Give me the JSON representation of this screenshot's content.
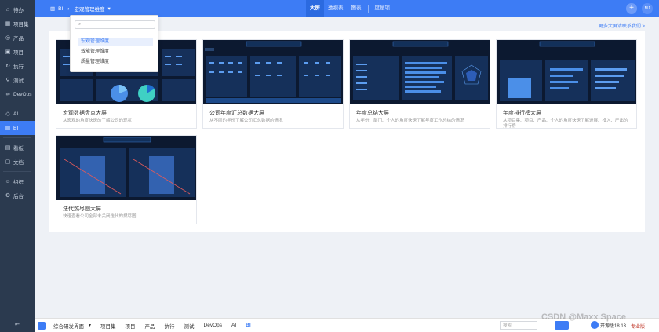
{
  "sidebar": {
    "items": [
      {
        "label": "待办",
        "icon": "home-icon"
      },
      {
        "label": "项目集",
        "icon": "project-set-icon"
      },
      {
        "label": "产品",
        "icon": "product-icon"
      },
      {
        "label": "项目",
        "icon": "project-icon"
      },
      {
        "label": "执行",
        "icon": "execution-icon"
      },
      {
        "label": "测试",
        "icon": "test-icon"
      },
      {
        "label": "DevOps",
        "icon": "devops-icon"
      },
      {
        "label": "AI",
        "icon": "ai-icon"
      },
      {
        "label": "BI",
        "icon": "bi-icon"
      },
      {
        "label": "看板",
        "icon": "kanban-icon"
      },
      {
        "label": "文档",
        "icon": "doc-icon"
      },
      {
        "label": "组织",
        "icon": "org-icon"
      },
      {
        "label": "后台",
        "icon": "admin-icon"
      }
    ],
    "collapse": "⇤"
  },
  "topbar": {
    "module": "BI",
    "dimension": "宏观管理维度",
    "tabs": [
      "大屏",
      "透视表",
      "图表",
      "度量项"
    ],
    "avatar": "MJ",
    "accent": "#3d7cf5"
  },
  "dropdown": {
    "search_placeholder": "",
    "options": [
      "宏观管理维度",
      "效能管理维度",
      "质量管理维度"
    ]
  },
  "more_link": "更多大屏请联系我们 >",
  "cards": [
    {
      "title": "宏观数据盘点大屏",
      "desc": "从宏观的角度快速的了解公司的现状"
    },
    {
      "title": "公司年度汇总数据大屏",
      "desc": "从不同的年份了解公司汇总数据的情况"
    },
    {
      "title": "年度总结大屏",
      "desc": "从年份、部门、个人的角度快速了解年度工作总结的情况"
    },
    {
      "title": "年度排行榜大屏",
      "desc": "从项目集、项目、产品、个人的角度快速了解进展、投入、产出的排行榜"
    },
    {
      "title": "迭代燃尽图大屏",
      "desc": "快速查看公司全部未关闭迭代的燃尽图"
    }
  ],
  "bottombar": {
    "workspace": "综合研发界面",
    "items": [
      "项目集",
      "项目",
      "产品",
      "执行",
      "测试",
      "DevOps",
      "AI",
      "BI"
    ],
    "search_placeholder": "搜索",
    "user": "开源版18.13",
    "status": "专业版"
  },
  "watermark": "CSDN @Maxx Space"
}
